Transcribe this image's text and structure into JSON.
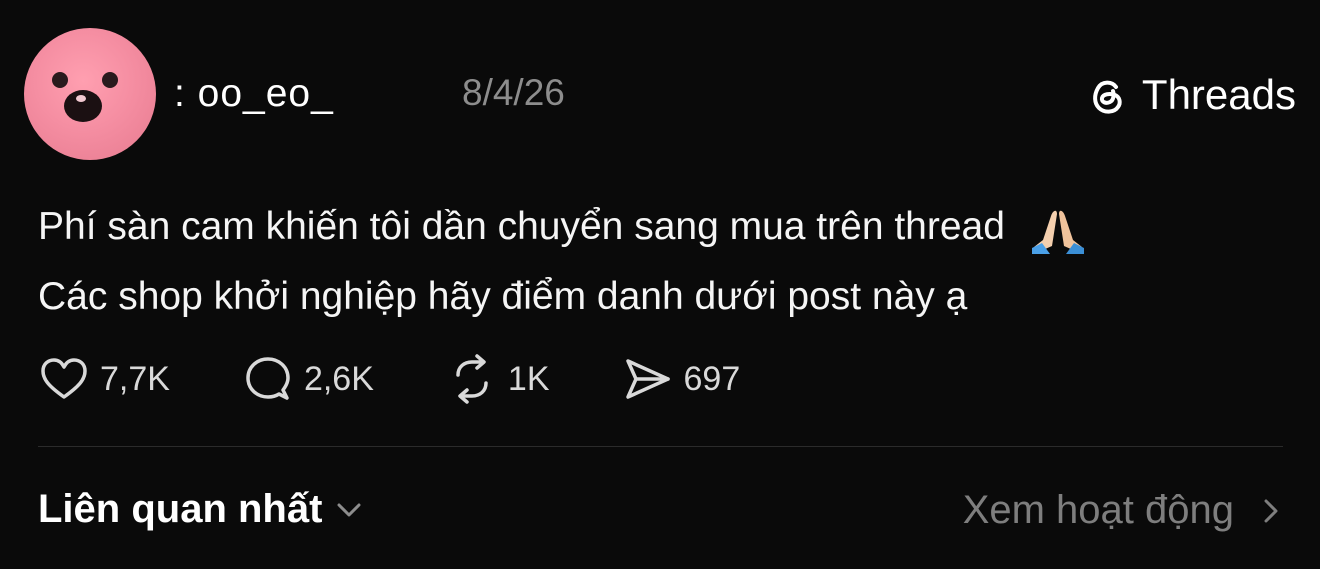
{
  "post": {
    "username": ": oo_eo_",
    "timestamp": "8/4/26",
    "app_name": "Threads",
    "content_line1": "Phí sàn cam khiến tôi dần chuyển sang mua trên thread",
    "content_line2": "Các shop khởi nghiệp hãy điểm danh dưới post này ạ",
    "emoji": "folded-hands-emoji"
  },
  "actions": {
    "likes": "7,7K",
    "comments": "2,6K",
    "reposts": "1K",
    "shares": "697"
  },
  "footer": {
    "sort_label": "Liên quan nhất",
    "activity_label": "Xem hoạt động"
  },
  "colors": {
    "background": "#0a0a0a",
    "text_primary": "#f5f5f5",
    "text_secondary": "#8d8d8d",
    "divider": "#2b2b2b",
    "avatar_pink": "#f58ea2"
  }
}
